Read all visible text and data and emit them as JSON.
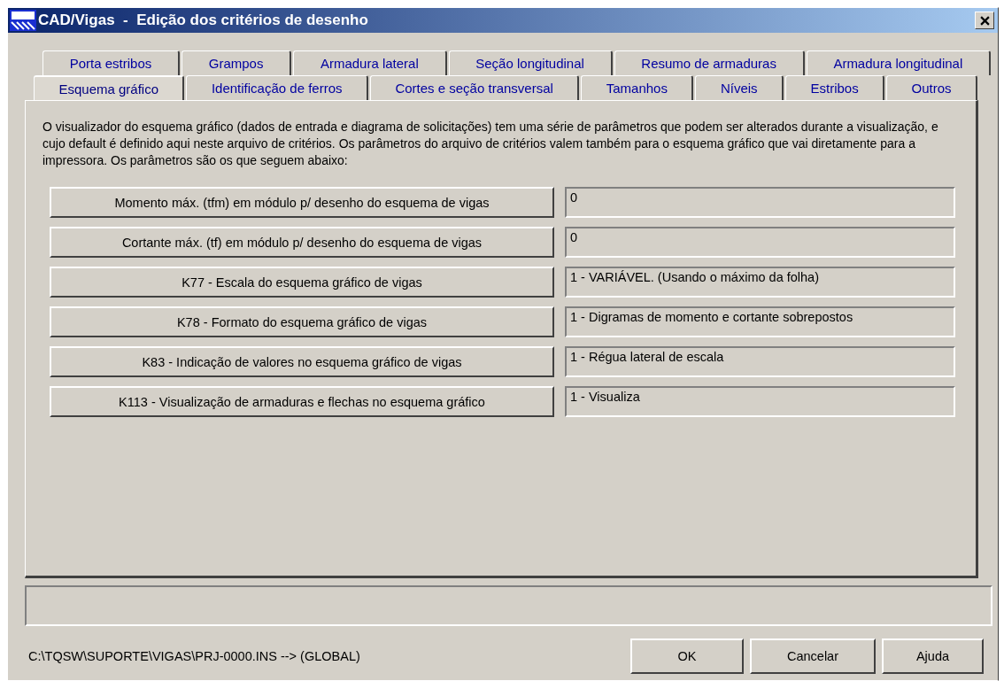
{
  "window": {
    "title": "CAD/Vigas  -  Edição dos critérios de desenho"
  },
  "tab_rows": [
    {
      "tabs": [
        {
          "label": "Porta estribos",
          "selected": false
        },
        {
          "label": "Grampos",
          "selected": false
        },
        {
          "label": "Armadura lateral",
          "selected": false
        },
        {
          "label": "Seção longitudinal",
          "selected": false
        },
        {
          "label": "Resumo de armaduras",
          "selected": false
        },
        {
          "label": "Armadura longitudinal",
          "selected": false
        }
      ]
    },
    {
      "tabs": [
        {
          "label": "Esquema gráfico",
          "selected": true
        },
        {
          "label": "Identificação de ferros",
          "selected": false
        },
        {
          "label": "Cortes e seção transversal",
          "selected": false
        },
        {
          "label": "Tamanhos",
          "selected": false
        },
        {
          "label": "Níveis",
          "selected": false
        },
        {
          "label": "Estribos",
          "selected": false
        },
        {
          "label": "Outros",
          "selected": false
        }
      ]
    }
  ],
  "description": "O visualizador do esquema gráfico (dados de entrada e diagrama de solicitações) tem uma série de parâmetros que podem ser alterados durante a visualização, e cujo default é definido aqui neste arquivo de critérios. Os parâmetros do arquivo de critérios valem também para o esquema gráfico que vai diretamente para a impressora. Os parâmetros são os que seguem abaixo:",
  "parameters": [
    {
      "button": "Momento máx. (tfm) em módulo p/ desenho do esquema de vigas",
      "value": "0"
    },
    {
      "button": "Cortante máx. (tf) em módulo p/ desenho do esquema de vigas",
      "value": "0"
    },
    {
      "button": "K77 - Escala do esquema gráfico de vigas",
      "value": "1 - VARIÁVEL. (Usando o máximo da folha)"
    },
    {
      "button": "K78 - Formato do esquema gráfico de vigas",
      "value": "1 - Digramas de momento e cortante sobrepostos"
    },
    {
      "button": "K83 - Indicação de valores no esquema gráfico de vigas",
      "value": "1 - Régua lateral de escala"
    },
    {
      "button": "K113 - Visualização de armaduras e flechas no esquema gráfico",
      "value": "1 - Visualiza"
    }
  ],
  "file_path": "C:\\TQSW\\SUPORTE\\VIGAS\\PRJ-0000.INS --> (GLOBAL)",
  "buttons": [
    "OK",
    "Cancelar",
    "Ajuda"
  ]
}
